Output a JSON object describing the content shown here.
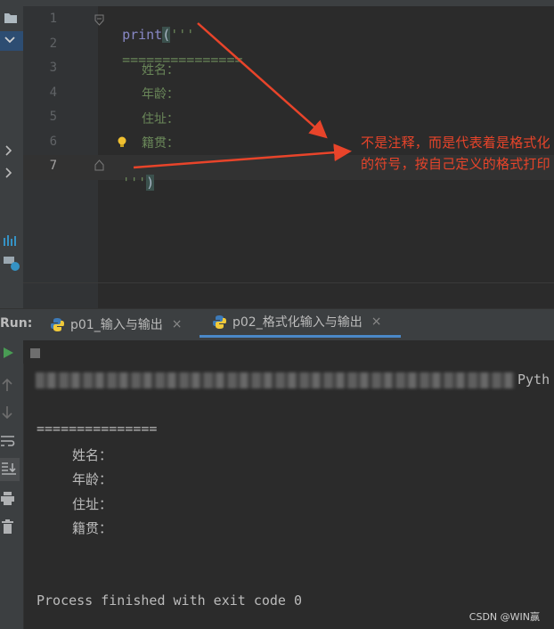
{
  "editor": {
    "line_numbers": [
      "1",
      "2",
      "3",
      "4",
      "5",
      "6",
      "7"
    ],
    "active_line": "7",
    "lines": {
      "l1_kw": "print",
      "l1_paren": "(",
      "l1_str": "'''",
      "l2": "===============",
      "l3": "姓名：",
      "l4": "年龄：",
      "l5": "住址：",
      "l6": "籍贯：",
      "l7_str": "'''",
      "l7_paren": ")"
    }
  },
  "annotation": {
    "text": "不是注释，而是代表着是格式化的符号，按自己定义的格式打印",
    "color": "#e8442a"
  },
  "run_panel": {
    "label": "Run:",
    "tabs": [
      {
        "label": "p01_输入与输出",
        "close": "×"
      },
      {
        "label": "p02_格式化输入与输出",
        "close": "×"
      }
    ],
    "active_tab": 1,
    "console": {
      "first_line_tail": "Pyth",
      "separator": "===============",
      "lines": [
        "姓名：",
        "年龄：",
        "住址：",
        "籍贯："
      ],
      "exit": "Process finished with exit code 0"
    }
  },
  "watermark": "CSDN @WIN赢",
  "icons": [
    "folder-icon",
    "chevron-down-icon",
    "chevron-right-icon",
    "chart-icon",
    "cloud-icon",
    "run-icon",
    "stop-icon",
    "arrow-up-icon",
    "arrow-down-icon",
    "soft-wrap-icon",
    "scroll-end-icon",
    "print-icon",
    "trash-icon",
    "python-icon",
    "bulb-icon",
    "fold-icon"
  ],
  "colors": {
    "accent": "#4a88c7",
    "run_green": "#499c54",
    "string": "#6a8759",
    "keyword": "#8888c6"
  }
}
